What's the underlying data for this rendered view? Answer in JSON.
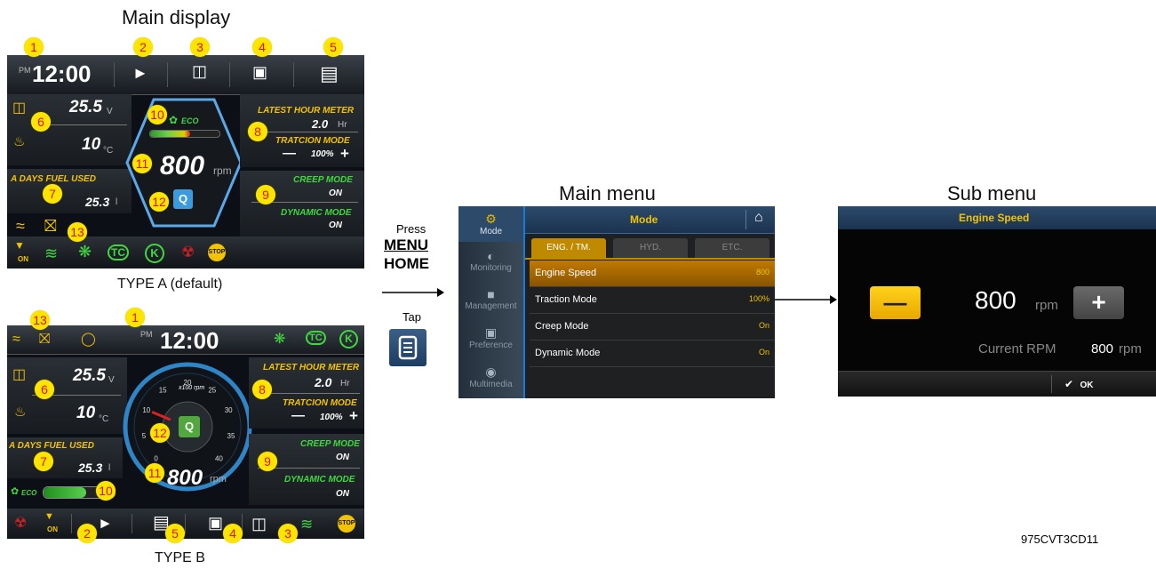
{
  "captions": {
    "main_display": "Main display",
    "type_a": "TYPE A (default)",
    "type_b": "TYPE B",
    "main_menu": "Main menu",
    "sub_menu": "Sub menu",
    "press": "Press",
    "menu": "MENU",
    "home": "HOME",
    "tap": "Tap",
    "figure_code": "975CVT3CD11"
  },
  "markers": [
    "1",
    "2",
    "3",
    "4",
    "5",
    "6",
    "7",
    "8",
    "9",
    "10",
    "11",
    "12",
    "13"
  ],
  "type_a": {
    "clock_ampm": "PM",
    "clock_time": "12:00",
    "voltage_value": "25.5",
    "voltage_unit": "V",
    "temp_value": "10",
    "temp_unit": "°C",
    "fuel_label": "A DAYS FUEL USED",
    "fuel_value": "25.3",
    "fuel_unit": "l",
    "eco_label": "ECO",
    "rpm_value": "800",
    "rpm_unit": "rpm",
    "gear_letter": "Q",
    "hour_meter_label": "LATEST HOUR METER",
    "hour_meter_value": "2.0",
    "hour_meter_unit": "Hr",
    "traction_label": "TRATCION MODE",
    "traction_value": "100%",
    "traction_minus": "—",
    "traction_plus": "+",
    "creep_label": "CREEP MODE",
    "creep_value": "ON",
    "dynamic_label": "DYNAMIC MODE",
    "dynamic_value": "ON",
    "on_badge": "ON",
    "tc_badge": "TC",
    "k_badge": "K",
    "stop_badge": "STOP"
  },
  "type_b": {
    "clock_ampm": "PM",
    "clock_time": "12:00",
    "voltage_value": "25.5",
    "voltage_unit": "V",
    "temp_value": "10",
    "temp_unit": "°C",
    "fuel_label": "A DAYS FUEL USED",
    "fuel_value": "25.3",
    "fuel_unit": "l",
    "eco_label": "ECO",
    "rpm_value": "800",
    "rpm_unit": "rpm",
    "gauge_unit": "x100 rpm",
    "gauge_ticks": [
      "0",
      "5",
      "10",
      "15",
      "20",
      "25",
      "30",
      "35",
      "40"
    ],
    "gauge_needle_value": 10,
    "gear_letter": "Q",
    "hour_meter_label": "LATEST HOUR METER",
    "hour_meter_value": "2.0",
    "hour_meter_unit": "Hr",
    "traction_label": "TRATCION MODE",
    "traction_value": "100%",
    "traction_minus": "—",
    "traction_plus": "+",
    "creep_label": "CREEP MODE",
    "creep_value": "ON",
    "dynamic_label": "DYNAMIC MODE",
    "dynamic_value": "ON",
    "on_badge": "ON",
    "tc_badge": "TC",
    "k_badge": "K",
    "stop_badge": "STOP"
  },
  "main_menu": {
    "title": "Mode",
    "sidebar": [
      {
        "label": "Mode",
        "icon": "gear-icon"
      },
      {
        "label": "Monitoring",
        "icon": "gauge-icon"
      },
      {
        "label": "Management",
        "icon": "lock-icon"
      },
      {
        "label": "Preference",
        "icon": "monitor-icon"
      },
      {
        "label": "Multimedia",
        "icon": "media-icon"
      }
    ],
    "tabs": [
      "ENG. / TM.",
      "HYD.",
      "ETC."
    ],
    "rows": [
      {
        "label": "Engine Speed",
        "value": "800"
      },
      {
        "label": "Traction Mode",
        "value": "100%"
      },
      {
        "label": "Creep Mode",
        "value": "On"
      },
      {
        "label": "Dynamic Mode",
        "value": "On"
      }
    ]
  },
  "sub_menu": {
    "title": "Engine Speed",
    "value": "800",
    "unit": "rpm",
    "minus": "—",
    "plus": "+",
    "current_label": "Current RPM",
    "current_value": "800",
    "current_unit": "rpm",
    "ok_label": "OK"
  },
  "colors": {
    "yellow": "#f2c300",
    "green": "#3fd83f",
    "marker_fill": "#ffe400",
    "marker_text": "#e01010",
    "menu_highlight": "#a86a00",
    "accent_blue": "#1a7ad8"
  }
}
